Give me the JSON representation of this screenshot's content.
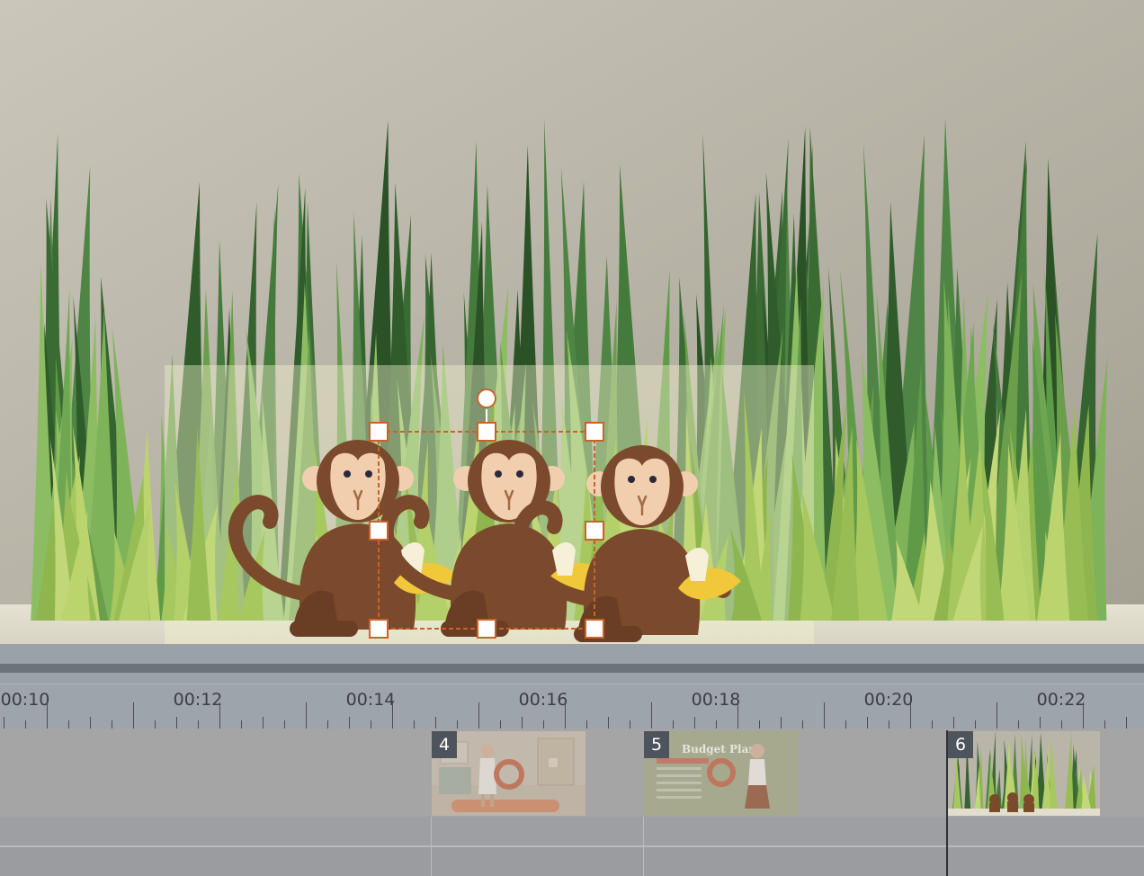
{
  "canvas": {
    "background_color": "#c8c4b8",
    "floor_color": "#ece9dc",
    "selection_color": "#c8622a",
    "selected_object": "monkey-group"
  },
  "timeline": {
    "ruler_labels": [
      "00:10",
      "00:12",
      "00:14",
      "00:16",
      "00:18",
      "00:20",
      "00:22"
    ],
    "clips": [
      {
        "badge": "4",
        "scene": "woman-presenter-living-room"
      },
      {
        "badge": "5",
        "scene": "budget-plan",
        "title": "Budget Plan"
      },
      {
        "badge": "6",
        "scene": "grass-monkeys"
      }
    ]
  }
}
